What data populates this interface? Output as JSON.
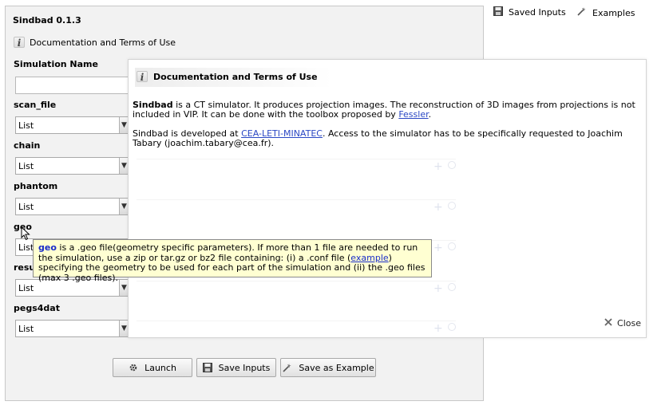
{
  "app": {
    "title": "Sindbad 0.1.3",
    "doc_link": "Documentation and Terms of Use"
  },
  "top_links": {
    "saved_inputs": "Saved Inputs",
    "examples": "Examples"
  },
  "form": {
    "simulation_name": {
      "label": "Simulation Name",
      "value": ""
    },
    "fields": [
      {
        "label": "scan_file",
        "value": "List"
      },
      {
        "label": "chain",
        "value": "List"
      },
      {
        "label": "phantom",
        "value": "List"
      },
      {
        "label": "geo",
        "value": "List"
      },
      {
        "label": "resu",
        "value": "List"
      },
      {
        "label": "pegs4dat",
        "value": "List"
      }
    ]
  },
  "buttons": {
    "launch": "Launch",
    "save_inputs": "Save Inputs",
    "save_example": "Save as Example"
  },
  "doc_popup": {
    "title": "Documentation and Terms of Use",
    "p1_name": "Sindbad",
    "p1_text": " is a CT simulator. It produces projection images. The reconstruction of 3D images from projections is not included in VIP. It can be done with the toolbox proposed by ",
    "p1_link": "Fessler",
    "p1_end": ".",
    "p2_text": "Sindbad is developed at ",
    "p2_link": "CEA-LETI-MINATEC",
    "p2_end": ". Access to the simulator has to be specifically requested to Joachim Tabary (joachim.tabary@cea.fr).",
    "close_label": "Close"
  },
  "tooltip": {
    "term": "geo",
    "text1": " is a .geo file(geometry specific parameters). If more than 1 file are needed to run the simulation, use a zip or tar.gz or bz2 file containing: (i) a .conf file (",
    "link": "example",
    "text2": ") specifying the geometry to be used for each part of the simulation and (ii) the .geo files (max 3 .geo files)."
  },
  "colors": {
    "tooltip_bg": "#ffffd2",
    "link": "#2a47c4",
    "panel_bg": "#f2f2f2"
  }
}
